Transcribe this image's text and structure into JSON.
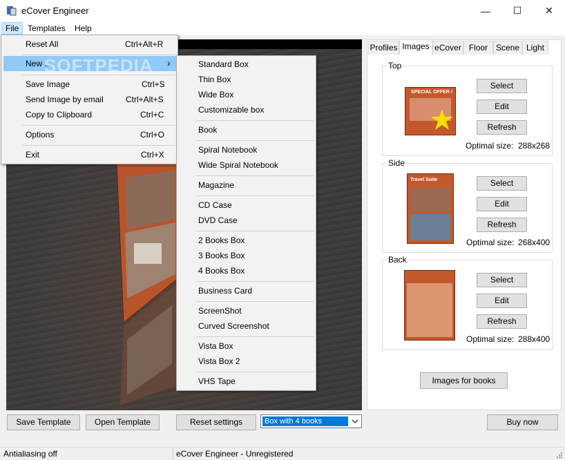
{
  "window": {
    "title": "eCover Engineer",
    "minimize": "—",
    "maximize": "☐",
    "close": "✕"
  },
  "menubar": {
    "file": "File",
    "templates": "Templates",
    "help": "Help"
  },
  "file_menu": {
    "reset_all": "Reset All",
    "reset_all_key": "Ctrl+Alt+R",
    "new": "New ...",
    "new_arrow": "›",
    "save_image": "Save Image",
    "save_image_key": "Ctrl+S",
    "send_email": "Send Image by email",
    "send_email_key": "Ctrl+Alt+S",
    "copy_clipboard": "Copy to Clipboard",
    "copy_clipboard_key": "Ctrl+C",
    "options": "Options",
    "options_key": "Ctrl+O",
    "exit": "Exit",
    "exit_key": "Ctrl+X"
  },
  "watermark": "SOFTPEDIA",
  "new_submenu": [
    "Standard Box",
    "Thin Box",
    "Wide Box",
    "Customizable box",
    "Book",
    "Spiral Notebook",
    "Wide Spiral Notebook",
    "Magazine",
    "CD Case",
    "DVD Case",
    "2 Books Box",
    "3 Books Box",
    "4 Books Box",
    "Business Card",
    "ScreenShot",
    "Curved Screenshot",
    "Vista Box",
    "Vista Box 2",
    "VHS Tape"
  ],
  "tabs": [
    "Profiles",
    "Images",
    "eCover",
    "Floor",
    "Scene",
    "Light"
  ],
  "images": {
    "top": {
      "label": "Top",
      "optimal_label": "Optimal size:",
      "optimal_value": "288x268",
      "thumb_text": "SPECIAL OFFER !"
    },
    "side": {
      "label": "Side",
      "optimal_label": "Optimal size:",
      "optimal_value": "268x400",
      "thumb_text": "Travel Suite"
    },
    "back": {
      "label": "Back",
      "optimal_label": "Optimal size:",
      "optimal_value": "288x400"
    },
    "select": "Select",
    "edit": "Edit",
    "refresh": "Refresh",
    "images_for_books": "Images for books"
  },
  "bottom": {
    "save_template": "Save Template",
    "open_template": "Open Template",
    "reset_settings": "Reset settings",
    "combo_value": "Box with 4 books",
    "buy_now": "Buy now"
  },
  "status": {
    "left": "Antialiasing off",
    "right": "eCover Engineer - Unregistered"
  },
  "colors": {
    "accent": "#0078d7",
    "cover": "#c4582d",
    "menu_highlight": "#91c9f7"
  }
}
